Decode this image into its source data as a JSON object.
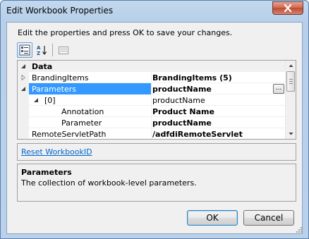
{
  "window": {
    "title": "Edit Workbook Properties",
    "close_icon": "close-icon"
  },
  "instructions": "Edit the properties and press OK to save your changes.",
  "toolbar": {
    "categorized_icon": "categorized-view-icon",
    "alphabetical_icon": "sort-alphabetical-icon",
    "property_pages_icon": "property-pages-icon"
  },
  "grid": {
    "category": "Data",
    "rows": [
      {
        "name": "BrandingItems",
        "value": "BrandingItems (5)"
      },
      {
        "name": "Parameters",
        "value": "productName"
      },
      {
        "name": "[0]",
        "value": "productName"
      },
      {
        "name": "Annotation",
        "value": "Product Name"
      },
      {
        "name": "Parameter",
        "value": "productName"
      },
      {
        "name": "RemoteServletPath",
        "value": "/adfdiRemoteServlet"
      }
    ],
    "ellipsis_label": "..."
  },
  "commands": {
    "reset_link": "Reset WorkbookID"
  },
  "description": {
    "title": "Parameters",
    "text": "The collection of workbook-level parameters."
  },
  "buttons": {
    "ok": "OK",
    "cancel": "Cancel"
  }
}
